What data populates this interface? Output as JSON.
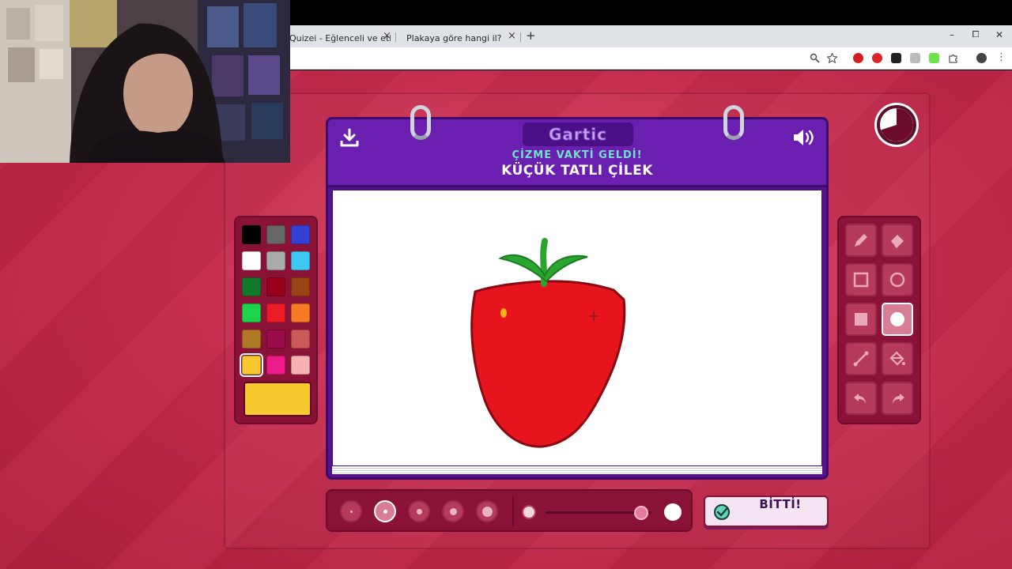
{
  "browser": {
    "tabs": [
      {
        "title": "Quizei - Eğlenceli ve etkileşiml"
      },
      {
        "title": "Plakaya göre hangi il? - Photo"
      }
    ],
    "new_tab_label": "+",
    "window_controls": {
      "minimize": "–",
      "maximize": "⧠",
      "close": "✕"
    }
  },
  "board": {
    "logo": "Gartic",
    "prompt": "ÇİZME VAKTİ GELDİ!",
    "word": "KÜÇÜK TATLI ÇİLEK"
  },
  "palette": {
    "colors": [
      "#000000",
      "#666666",
      "#3340d4",
      "#ffffff",
      "#aaaaaa",
      "#40c8f4",
      "#117a2a",
      "#99001a",
      "#994414",
      "#1fd44a",
      "#ec1c24",
      "#f47a24",
      "#b07a24",
      "#990a4a",
      "#cc5a5a",
      "#f7c830",
      "#ec1a8a",
      "#f8b0b0"
    ],
    "selected_index": 15,
    "current_color": "#f7c830"
  },
  "tools": [
    {
      "name": "pencil"
    },
    {
      "name": "eraser"
    },
    {
      "name": "rectangle-outline"
    },
    {
      "name": "ellipse-outline"
    },
    {
      "name": "rectangle-filled"
    },
    {
      "name": "ellipse-filled"
    },
    {
      "name": "line"
    },
    {
      "name": "fill-bucket"
    },
    {
      "name": "undo"
    },
    {
      "name": "redo"
    }
  ],
  "active_tool": "ellipse-filled",
  "brush": {
    "selected_size_index": 1,
    "opacity_fraction": 0.9
  },
  "timer": {
    "remaining_fraction": 0.7
  },
  "done_button": {
    "label": "BİTTİ!"
  },
  "colors": {
    "background": "#c52a4d",
    "panel": "#8a1236",
    "board": "#56128d",
    "drawing_red": "#e6151d",
    "drawing_green": "#2aa52f"
  }
}
